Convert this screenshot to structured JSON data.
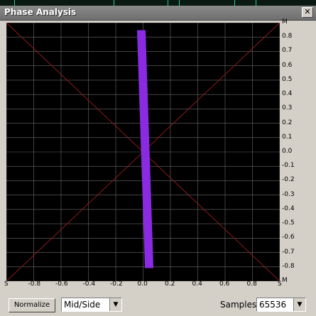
{
  "window": {
    "title": "Phase Analysis",
    "close_label": "✕"
  },
  "plot": {
    "y_labels": [
      "M",
      "0.8",
      "0.7",
      "0.6",
      "0.5",
      "0.4",
      "0.3",
      "0.2",
      "0.1",
      "0.0",
      "-0.1",
      "-0.2",
      "-0.3",
      "-0.4",
      "-0.5",
      "-0.6",
      "-0.7",
      "-0.8",
      "M"
    ],
    "x_labels": [
      "S",
      "-0.8",
      "-0.6",
      "-0.4",
      "-0.2",
      "0.0",
      "0.2",
      "0.4",
      "0.6",
      "0.8",
      "S"
    ],
    "trace_color": "#8a2be2",
    "grid_color": "#6b6b6b",
    "diagonal_color": "#8b1a1a"
  },
  "controls": {
    "normalize_label": "Normalize",
    "mode_value": "Mid/Side",
    "samples_label": "Samples",
    "samples_value": "65536"
  }
}
